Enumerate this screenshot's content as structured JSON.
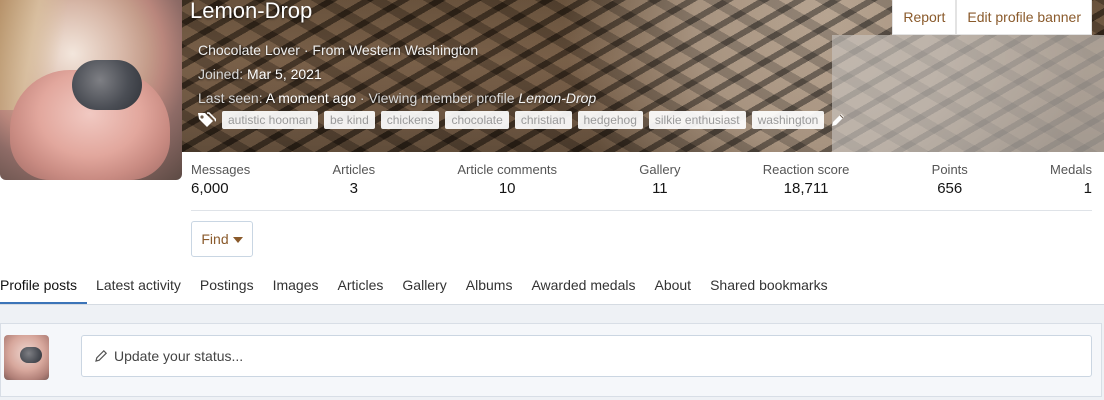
{
  "profile": {
    "username": "Lemon-Drop",
    "custom_title": "Chocolate Lover · From Western Washington",
    "joined_label": "Joined:",
    "joined_value": "Mar 5, 2021",
    "last_seen_label": "Last seen:",
    "last_seen_value": "A moment ago",
    "activity_prefix": "· Viewing member profile",
    "activity_target": "Lemon-Drop",
    "tags": [
      "autistic hooman",
      "be kind",
      "chickens",
      "chocolate",
      "christian",
      "hedgehog",
      "silkie enthusiast",
      "washington"
    ]
  },
  "banner_actions": {
    "report": "Report",
    "edit_banner": "Edit profile banner"
  },
  "stats": [
    {
      "label": "Messages",
      "value": "6,000"
    },
    {
      "label": "Articles",
      "value": "3"
    },
    {
      "label": "Article comments",
      "value": "10"
    },
    {
      "label": "Gallery",
      "value": "11"
    },
    {
      "label": "Reaction score",
      "value": "18,711"
    },
    {
      "label": "Points",
      "value": "656"
    },
    {
      "label": "Medals",
      "value": "1"
    }
  ],
  "find_label": "Find",
  "tabs": [
    {
      "label": "Profile posts",
      "active": true
    },
    {
      "label": "Latest activity",
      "active": false
    },
    {
      "label": "Postings",
      "active": false
    },
    {
      "label": "Images",
      "active": false
    },
    {
      "label": "Articles",
      "active": false
    },
    {
      "label": "Gallery",
      "active": false
    },
    {
      "label": "Albums",
      "active": false
    },
    {
      "label": "Awarded medals",
      "active": false
    },
    {
      "label": "About",
      "active": false
    },
    {
      "label": "Shared bookmarks",
      "active": false
    }
  ],
  "status": {
    "placeholder": "Update your status..."
  },
  "colors": {
    "link": "#8a5a2b",
    "tab_active_underline": "#3b74b8"
  },
  "icons": {
    "tags": "tags-icon",
    "edit_tags": "pencil-icon",
    "find_caret": "caret-down-icon",
    "status_edit": "pencil-icon"
  }
}
